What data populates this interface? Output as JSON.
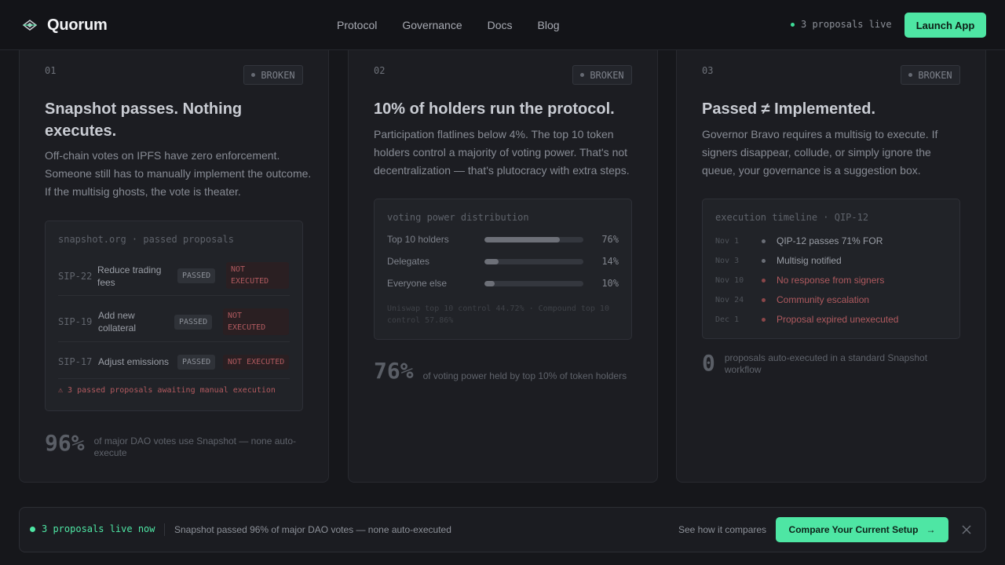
{
  "header": {
    "brand": "Quorum",
    "nav": [
      "Protocol",
      "Governance",
      "Docs",
      "Blog"
    ],
    "live_text": "3 proposals live",
    "launch_label": "Launch App"
  },
  "cards": [
    {
      "num": "01",
      "badge": "BROKEN",
      "title": "Snapshot passes. Nothing executes.",
      "desc": "Off-chain votes on IPFS have zero enforcement. Someone still has to manually implement the outcome. If the multisig ghosts, the vote is theater.",
      "panel_title": "snapshot.org · passed proposals",
      "rows": [
        {
          "id": "SIP-22",
          "name": "Reduce trading fees",
          "status": "PASSED",
          "exec": "NOT EXECUTED"
        },
        {
          "id": "SIP-19",
          "name": "Add new collateral",
          "status": "PASSED",
          "exec": "NOT EXECUTED"
        },
        {
          "id": "SIP-17",
          "name": "Adjust emissions",
          "status": "PASSED",
          "exec": "NOT EXECUTED"
        }
      ],
      "warning": "⚠ 3 passed proposals awaiting manual execution",
      "stat_num": "96%",
      "stat_text": "of major DAO votes use Snapshot — none auto-execute"
    },
    {
      "num": "02",
      "badge": "BROKEN",
      "title": "10% of holders run the protocol.",
      "desc": "Participation flatlines below 4%. The top 10 token holders control a majority of voting power. That's not decentralization — that's plutocracy with extra steps.",
      "panel_title": "voting power distribution",
      "bars": [
        {
          "label": "Top 10 holders",
          "pct": 76,
          "pct_label": "76%"
        },
        {
          "label": "Delegates",
          "pct": 14,
          "pct_label": "14%"
        },
        {
          "label": "Everyone else",
          "pct": 10,
          "pct_label": "10%"
        }
      ],
      "footnote": "Uniswap top 10 control 44.72% · Compound top 10 control 57.86%",
      "stat_num": "76%",
      "stat_text": "of voting power held by top 10% of token holders"
    },
    {
      "num": "03",
      "badge": "BROKEN",
      "title": "Passed ≠ Implemented.",
      "desc": "Governor Bravo requires a multisig to execute. If signers disappear, collude, or simply ignore the queue, your governance is a suggestion box.",
      "panel_title": "execution timeline · QIP-12",
      "timeline": [
        {
          "date": "Nov 1",
          "text": "QIP-12 passes 71% FOR",
          "alert": false
        },
        {
          "date": "Nov 3",
          "text": "Multisig notified",
          "alert": false
        },
        {
          "date": "Nov 10",
          "text": "No response from signers",
          "alert": true
        },
        {
          "date": "Nov 24",
          "text": "Community escalation",
          "alert": true
        },
        {
          "date": "Dec 1",
          "text": "Proposal expired unexecuted",
          "alert": true
        }
      ],
      "stat_num": "0",
      "stat_text": "proposals auto-executed in a standard Snapshot workflow"
    }
  ],
  "bottom": {
    "live_text": "3 proposals live now",
    "message": "Snapshot passed 96% of major DAO votes — none auto-executed",
    "compare_text": "See how it compares",
    "cta": "Compare Your Current Setup",
    "cta_arrow": "→"
  },
  "colors": {
    "accent": "#4ee6a4",
    "alert": "#b05a5f",
    "bg": "#16171b"
  }
}
